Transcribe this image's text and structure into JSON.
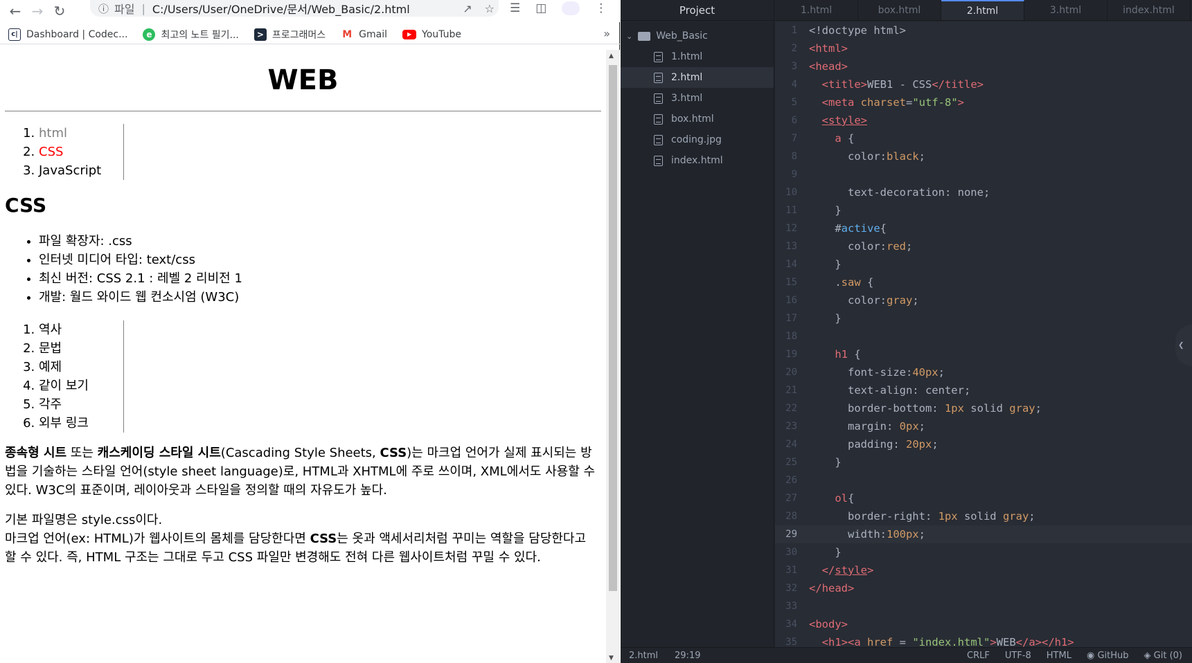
{
  "browser": {
    "omnibox": {
      "scheme_label": "파일",
      "url": "C:/Users/User/OneDrive/문서/Web_Basic/2.html"
    },
    "bookmarks": [
      {
        "label": "Dashboard | Codec...",
        "icon": "codecademy-icon"
      },
      {
        "label": "최고의 노트 필기...",
        "icon": "evernote-icon"
      },
      {
        "label": "프로그래머스",
        "icon": "programmers-icon"
      },
      {
        "label": "Gmail",
        "icon": "gmail-icon"
      },
      {
        "label": "YouTube",
        "icon": "youtube-icon"
      }
    ],
    "bookmarks_more": "»"
  },
  "page": {
    "title": "WEB",
    "toc": [
      "html",
      "CSS",
      "JavaScript"
    ],
    "heading": "CSS",
    "facts": [
      "파일 확장자: .css",
      "인터넷 미디어 타입: text/css",
      "최신 버전: CSS 2.1 : 레벨 2 리비전 1",
      "개발: 월드 와이드 웹 컨소시엄 (W3C)"
    ],
    "sections": [
      "역사",
      "문법",
      "예제",
      "같이 보기",
      "각주",
      "외부 링크"
    ],
    "intro": {
      "bold1": "종속형 시트",
      "t1": " 또는 ",
      "bold2": "캐스케이딩 스타일 시트",
      "t2": "(Cascading Style Sheets, ",
      "bold3": "CSS",
      "t3": ")는 마크업 언어가 실제 표시되는 방법을 기술하는 스타일 언어(style sheet language)로, HTML과 XHTML에 주로 쓰이며, XML에서도 사용할 수 있다. W3C의 표준이며, 레이아웃과 스타일을 정의할 때의 자유도가 높다."
    },
    "para2": {
      "line1": "기본 파일명은 style.css이다.",
      "t1": "마크업 언어(ex: HTML)가 웹사이트의 몸체를 담당한다면 ",
      "bold": "CSS",
      "t2": "는 옷과 액세서리처럼 꾸미는 역할을 담당한다고 할 수 있다. 즉, HTML 구조는 그대로 두고 CSS 파일만 변경해도 전혀 다른 웹사이트처럼 꾸밀 수 있다."
    }
  },
  "editor": {
    "tree_title": "Project",
    "root_folder": "Web_Basic",
    "files": [
      "1.html",
      "2.html",
      "3.html",
      "box.html",
      "coding.jpg",
      "index.html"
    ],
    "selected_file": "2.html",
    "tabs": [
      "1.html",
      "box.html",
      "2.html",
      "3.html",
      "index.html"
    ],
    "active_tab": "2.html",
    "cursor_line": 29,
    "status": {
      "file": "2.html",
      "position": "29:19",
      "eol": "CRLF",
      "encoding": "UTF-8",
      "grammar": "HTML",
      "github": "GitHub",
      "git": "Git (0)"
    },
    "code_lines": [
      [
        {
          "c": "plain",
          "t": "<!doctype html>"
        }
      ],
      [
        {
          "c": "tag",
          "t": "<html>"
        }
      ],
      [
        {
          "c": "tag",
          "t": "<head>"
        }
      ],
      [
        {
          "c": "plain",
          "t": "  "
        },
        {
          "c": "tag",
          "t": "<title>"
        },
        {
          "c": "plain",
          "t": "WEB1 - CSS"
        },
        {
          "c": "tag",
          "t": "</title>"
        }
      ],
      [
        {
          "c": "plain",
          "t": "  "
        },
        {
          "c": "tag",
          "t": "<meta "
        },
        {
          "c": "attr",
          "t": "charset"
        },
        {
          "c": "plain",
          "t": "="
        },
        {
          "c": "str",
          "t": "\"utf-8\""
        },
        {
          "c": "tag",
          "t": ">"
        }
      ],
      [
        {
          "c": "plain",
          "t": "  "
        },
        {
          "c": "tag ul",
          "t": "<style>"
        }
      ],
      [
        {
          "c": "plain",
          "t": "    "
        },
        {
          "c": "sel",
          "t": "a"
        },
        {
          "c": "plain",
          "t": " {"
        }
      ],
      [
        {
          "c": "plain",
          "t": "      color:"
        },
        {
          "c": "val",
          "t": "black"
        },
        {
          "c": "plain",
          "t": ";"
        }
      ],
      [],
      [
        {
          "c": "plain",
          "t": "      text-decoration: none;"
        }
      ],
      [
        {
          "c": "plain",
          "t": "    }"
        }
      ],
      [
        {
          "c": "plain",
          "t": "    #"
        },
        {
          "c": "idsel",
          "t": "active"
        },
        {
          "c": "plain",
          "t": "{"
        }
      ],
      [
        {
          "c": "plain",
          "t": "      color:"
        },
        {
          "c": "val",
          "t": "red"
        },
        {
          "c": "plain",
          "t": ";"
        }
      ],
      [
        {
          "c": "plain",
          "t": "    }"
        }
      ],
      [
        {
          "c": "plain",
          "t": "    ."
        },
        {
          "c": "attr",
          "t": "saw"
        },
        {
          "c": "plain",
          "t": " {"
        }
      ],
      [
        {
          "c": "plain",
          "t": "      color:"
        },
        {
          "c": "val",
          "t": "gray"
        },
        {
          "c": "plain",
          "t": ";"
        }
      ],
      [
        {
          "c": "plain",
          "t": "    }"
        }
      ],
      [],
      [
        {
          "c": "plain",
          "t": "    "
        },
        {
          "c": "sel",
          "t": "h1"
        },
        {
          "c": "plain",
          "t": " {"
        }
      ],
      [
        {
          "c": "plain",
          "t": "      font-size:"
        },
        {
          "c": "val",
          "t": "40px"
        },
        {
          "c": "plain",
          "t": ";"
        }
      ],
      [
        {
          "c": "plain",
          "t": "      text-align: center;"
        }
      ],
      [
        {
          "c": "plain",
          "t": "      border-bottom: "
        },
        {
          "c": "val",
          "t": "1px"
        },
        {
          "c": "plain",
          "t": " solid "
        },
        {
          "c": "val",
          "t": "gray"
        },
        {
          "c": "plain",
          "t": ";"
        }
      ],
      [
        {
          "c": "plain",
          "t": "      margin: "
        },
        {
          "c": "val",
          "t": "0px"
        },
        {
          "c": "plain",
          "t": ";"
        }
      ],
      [
        {
          "c": "plain",
          "t": "      padding: "
        },
        {
          "c": "val",
          "t": "20px"
        },
        {
          "c": "plain",
          "t": ";"
        }
      ],
      [
        {
          "c": "plain",
          "t": "    }"
        }
      ],
      [],
      [
        {
          "c": "plain",
          "t": "    "
        },
        {
          "c": "sel",
          "t": "ol"
        },
        {
          "c": "plain",
          "t": "{"
        }
      ],
      [
        {
          "c": "plain",
          "t": "      border-right: "
        },
        {
          "c": "val",
          "t": "1px"
        },
        {
          "c": "plain",
          "t": " solid "
        },
        {
          "c": "val",
          "t": "gray"
        },
        {
          "c": "plain",
          "t": ";"
        }
      ],
      [
        {
          "c": "plain",
          "t": "      width:"
        },
        {
          "c": "val",
          "t": "100px"
        },
        {
          "c": "plain",
          "t": ";"
        }
      ],
      [
        {
          "c": "plain",
          "t": "    }"
        }
      ],
      [
        {
          "c": "plain",
          "t": "  "
        },
        {
          "c": "tag",
          "t": "</"
        },
        {
          "c": "tag ul",
          "t": "style"
        },
        {
          "c": "tag",
          "t": ">"
        }
      ],
      [
        {
          "c": "tag",
          "t": "</head>"
        }
      ],
      [],
      [
        {
          "c": "tag",
          "t": "<body>"
        }
      ],
      [
        {
          "c": "plain",
          "t": "  "
        },
        {
          "c": "tag",
          "t": "<h1><a "
        },
        {
          "c": "attr",
          "t": "href"
        },
        {
          "c": "plain",
          "t": " = "
        },
        {
          "c": "str",
          "t": "\"index.html\""
        },
        {
          "c": "tag",
          "t": ">"
        },
        {
          "c": "plain",
          "t": "WEB"
        },
        {
          "c": "tag",
          "t": "</a></h1>"
        }
      ]
    ]
  }
}
